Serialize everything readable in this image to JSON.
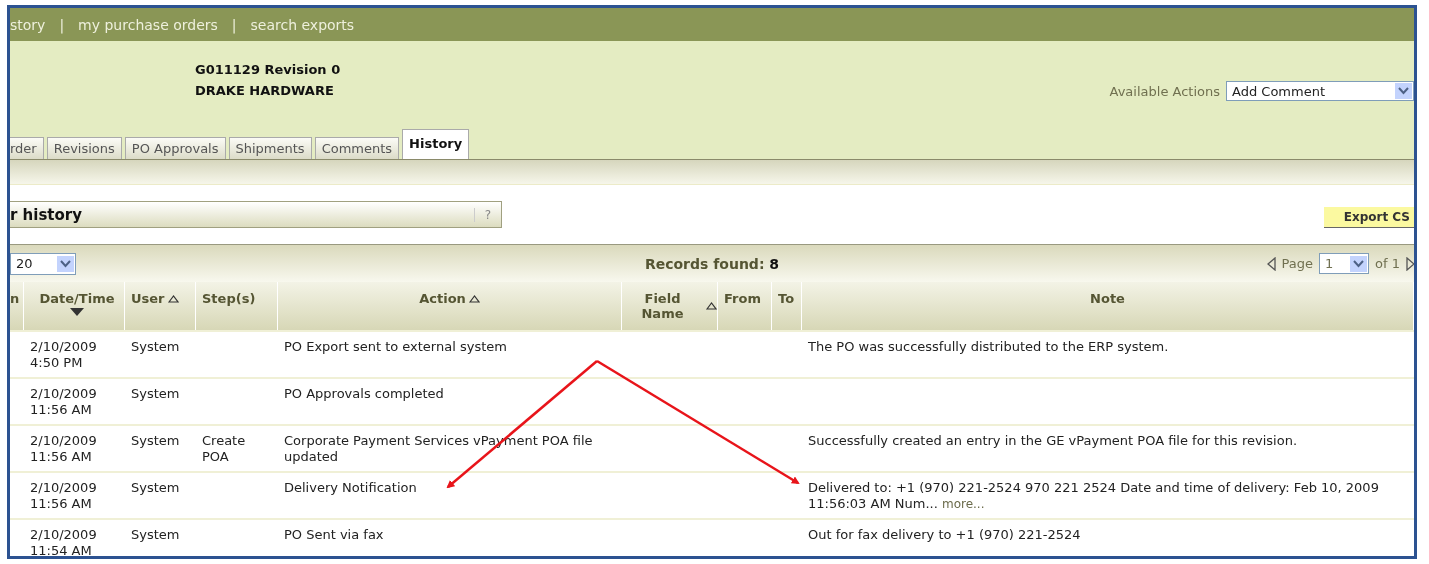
{
  "nav": {
    "links": [
      "story",
      "my purchase orders",
      "search exports"
    ],
    "separator": "|"
  },
  "header": {
    "title": "G011129 Revision 0",
    "supplier": "DRAKE HARDWARE",
    "actions_label": "Available Actions",
    "actions_value": "Add Comment"
  },
  "tabs": [
    {
      "label": "rder",
      "selected": false
    },
    {
      "label": "Revisions",
      "selected": false
    },
    {
      "label": "PO Approvals",
      "selected": false
    },
    {
      "label": "Shipments",
      "selected": false
    },
    {
      "label": "Comments",
      "selected": false
    },
    {
      "label": "History",
      "selected": true
    }
  ],
  "panel": {
    "title": "r history",
    "help": "?",
    "export_button": "Export CS"
  },
  "toolbar": {
    "page_size": "20",
    "records": "Records found: **8**",
    "page_label": "Page",
    "page": "1",
    "page_of": "of 1"
  },
  "table": {
    "columns": [
      {
        "label": "n",
        "sorted": false
      },
      {
        "label": "Date/Time",
        "sorted": true,
        "descending": true
      },
      {
        "label": "User",
        "sorted": true,
        "descending": false
      },
      {
        "label": "Step(s)",
        "sorted": false
      },
      {
        "label": "Action",
        "sorted": true,
        "descending": false
      },
      {
        "label": "Field Name",
        "sorted": true,
        "descending": false
      },
      {
        "label": "From",
        "sorted": false
      },
      {
        "label": "To",
        "sorted": false
      },
      {
        "label": "Note",
        "sorted": false
      }
    ],
    "rows": [
      {
        "date": "2/10/2009 4:50 PM",
        "user": "System",
        "action": "PO Export sent to external system",
        "note": "The PO was successfully distributed to the ERP system."
      },
      {
        "date": "2/10/2009 11:56 AM",
        "user": "System",
        "action": "PO Approvals completed"
      },
      {
        "date": "2/10/2009 11:56 AM",
        "user": "System",
        "step": "Create POA",
        "action": "Corporate Payment Services vPayment POA file updated",
        "note": "Successfully created an entry in the GE vPayment POA file for this revision."
      },
      {
        "date": "2/10/2009 11:56 AM",
        "user": "System",
        "action": "Delivery Notification",
        "note": "Delivered to: +1 (970) 221-2524 970 221 2524 Date and time of delivery: Feb 10, 2009 11:56:03 AM Num...",
        "more": "more..."
      },
      {
        "date": "2/10/2009 11:54 AM",
        "user": "System",
        "action": "PO Sent via fax",
        "note": "Out for fax delivery to +1 (970) 221-2524"
      }
    ]
  }
}
